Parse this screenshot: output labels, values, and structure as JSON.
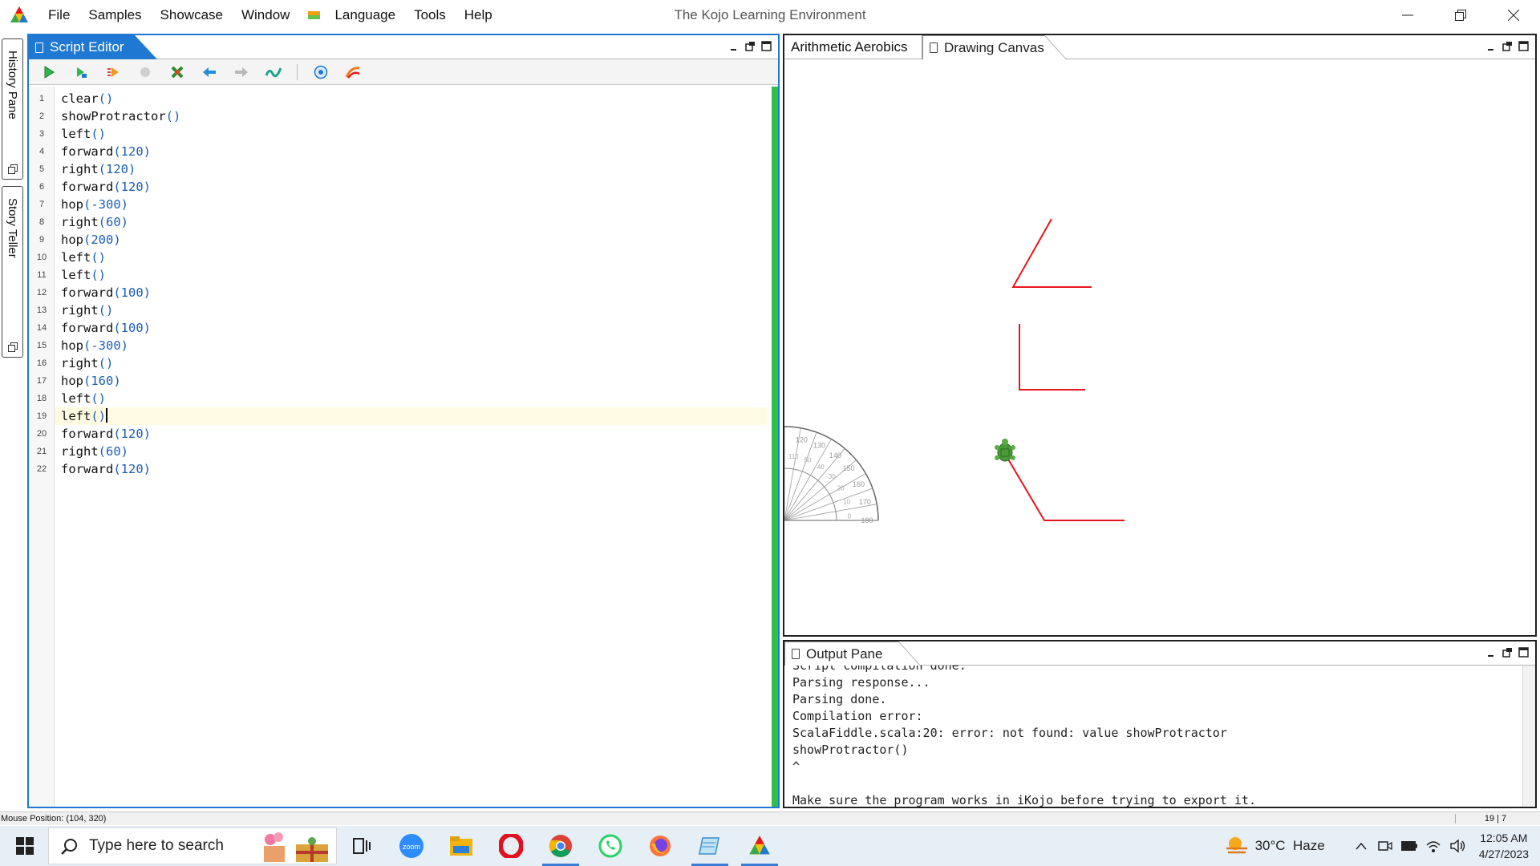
{
  "app": {
    "window_title": "The Kojo Learning Environment",
    "menu": [
      "File",
      "Samples",
      "Showcase",
      "Window",
      "Language",
      "Tools",
      "Help"
    ]
  },
  "side_tabs": [
    {
      "label": "History Pane"
    },
    {
      "label": "Story Teller"
    }
  ],
  "script_editor": {
    "tab_label": "Script Editor",
    "toolbar_buttons": [
      "run-icon",
      "run-worksheet-icon",
      "trace-icon",
      "stop-icon",
      "clear-icon",
      "undo-icon",
      "redo-icon",
      "format-icon",
      "help-icon",
      "export-icon"
    ],
    "current_line": 19,
    "lines": [
      {
        "num": "1",
        "call": "clear",
        "args": "()"
      },
      {
        "num": "2",
        "call": "showProtractor",
        "args": "()"
      },
      {
        "num": "3",
        "call": "left",
        "args": "()"
      },
      {
        "num": "4",
        "call": "forward",
        "args": "(120)"
      },
      {
        "num": "5",
        "call": "right",
        "args": "(120)"
      },
      {
        "num": "6",
        "call": "forward",
        "args": "(120)"
      },
      {
        "num": "7",
        "call": "hop",
        "args": "(-300)"
      },
      {
        "num": "8",
        "call": "right",
        "args": "(60)"
      },
      {
        "num": "9",
        "call": "hop",
        "args": "(200)"
      },
      {
        "num": "10",
        "call": "left",
        "args": "()"
      },
      {
        "num": "11",
        "call": "left",
        "args": "()"
      },
      {
        "num": "12",
        "call": "forward",
        "args": "(100)"
      },
      {
        "num": "13",
        "call": "right",
        "args": "()"
      },
      {
        "num": "14",
        "call": "forward",
        "args": "(100)"
      },
      {
        "num": "15",
        "call": "hop",
        "args": "(-300)"
      },
      {
        "num": "16",
        "call": "right",
        "args": "()"
      },
      {
        "num": "17",
        "call": "hop",
        "args": "(160)"
      },
      {
        "num": "18",
        "call": "left",
        "args": "()"
      },
      {
        "num": "19",
        "call": "left",
        "args": "()"
      },
      {
        "num": "20",
        "call": "forward",
        "args": "(120)"
      },
      {
        "num": "21",
        "call": "right",
        "args": "(60)"
      },
      {
        "num": "22",
        "call": "forward",
        "args": "(120)"
      }
    ]
  },
  "canvas_panel": {
    "tabs": [
      "Arithmetic Aerobics",
      "Drawing Canvas"
    ],
    "active_tab": "Drawing Canvas",
    "stroke_color": "#e8141b",
    "protractor_labels": [
      "120",
      "130",
      "140",
      "150",
      "160",
      "170",
      "180",
      "110",
      "50",
      "40",
      "30",
      "20",
      "10",
      "0"
    ]
  },
  "output_pane": {
    "tab_label": "Output Pane",
    "lines": [
      "Script compilation done.",
      "Parsing response...",
      "Parsing done.",
      "Compilation error:",
      "ScalaFiddle.scala:20: error: not found: value showProtractor",
      "showProtractor()",
      "^",
      "",
      "Make sure the program works in iKojo before trying to export it."
    ]
  },
  "status": {
    "mouse_position": "Mouse Position: (104, 320)",
    "cursor_position": "19 | 7"
  },
  "taskbar": {
    "search_placeholder": "Type here to search",
    "apps": [
      "task-view-icon",
      "zoom-icon",
      "file-explorer-icon",
      "opera-icon",
      "chrome-icon",
      "whatsapp-icon",
      "firefox-icon",
      "notepad-icon",
      "kojo-icon"
    ],
    "weather": "30°C  Haze",
    "time": "12:05 AM",
    "date": "4/27/2023"
  },
  "colors": {
    "accent": "#1f78d1",
    "editor_strip": "#2ec14a",
    "turtle": "#4a9a3a"
  }
}
